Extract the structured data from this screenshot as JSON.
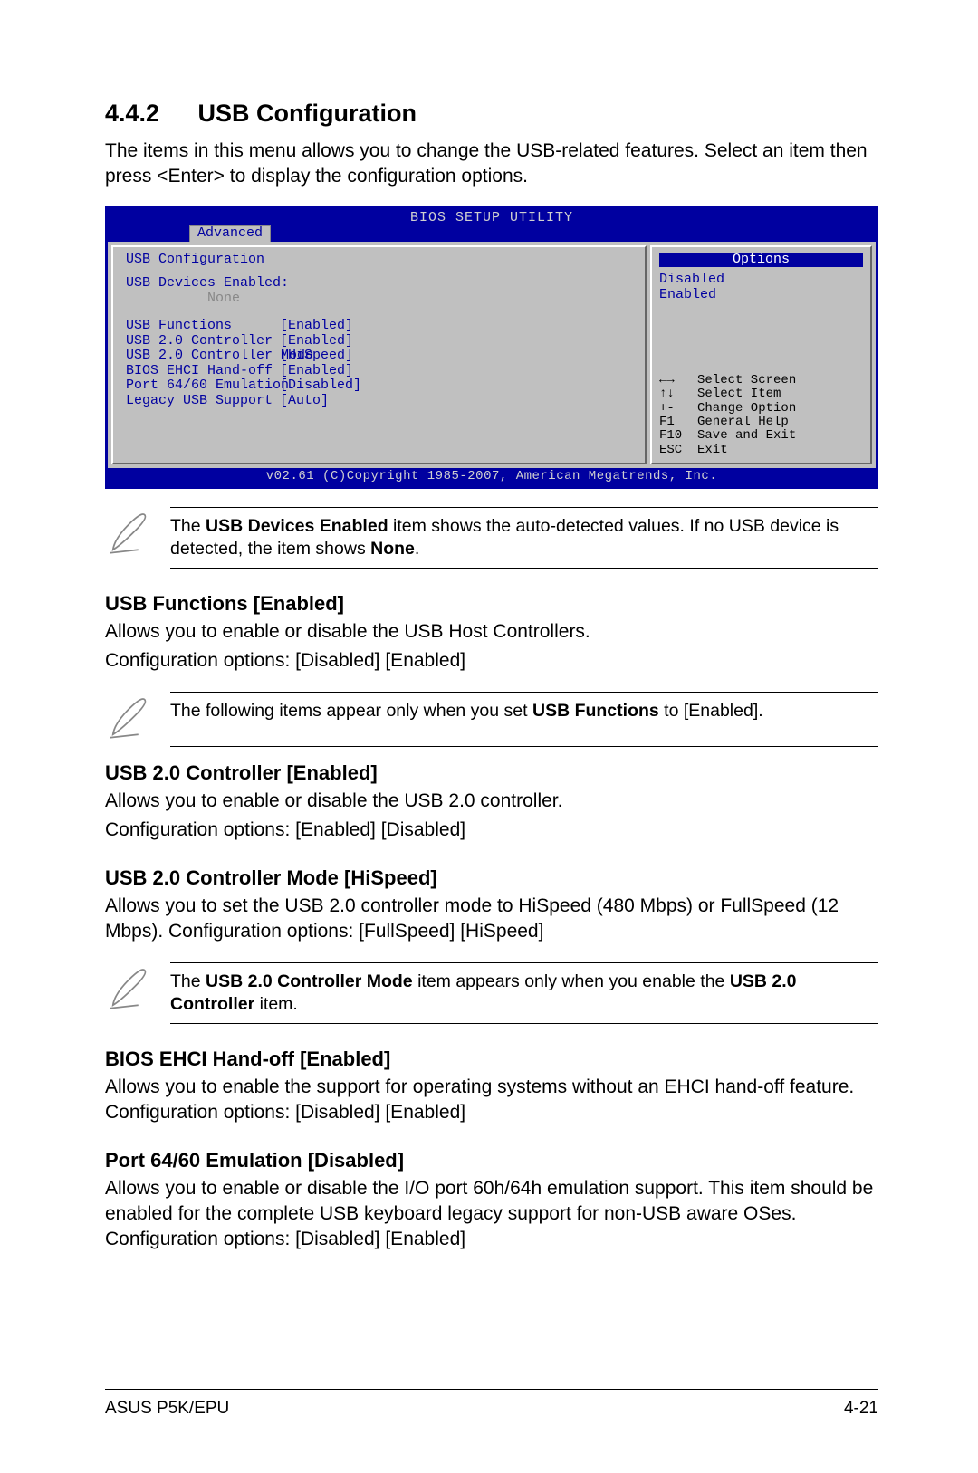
{
  "section": {
    "number": "4.4.2",
    "title": "USB Configuration"
  },
  "intro": "The items in this menu allows you to change the USB-related features. Select an item then press <Enter> to display the configuration options.",
  "bios": {
    "banner": "BIOS SETUP UTILITY",
    "tab": "Advanced",
    "menu_title": "USB Configuration",
    "devices_label": "USB Devices Enabled:",
    "devices_value": "None",
    "rows": [
      {
        "label": "USB Functions",
        "value": "[Enabled]"
      },
      {
        "label": "USB 2.0 Controller",
        "value": "[Enabled]"
      },
      {
        "label": "USB 2.0 Controller Mode",
        "value": "[HiSpeed]"
      },
      {
        "label": "BIOS EHCI Hand-off",
        "value": "[Enabled]"
      },
      {
        "label": "Port 64/60 Emulation",
        "value": "[Disabled]"
      },
      {
        "label": "Legacy USB Support",
        "value": "[Auto]"
      }
    ],
    "options_header": "Options",
    "options": [
      "Disabled",
      "Enabled"
    ],
    "help": [
      {
        "key": "←→",
        "text": "Select Screen"
      },
      {
        "key": "↑↓",
        "text": "Select Item"
      },
      {
        "key": "+-",
        "text": "Change Option"
      },
      {
        "key": "F1",
        "text": "General Help"
      },
      {
        "key": "F10",
        "text": "Save and Exit"
      },
      {
        "key": "ESC",
        "text": "Exit"
      }
    ],
    "copyright": "v02.61 (C)Copyright 1985-2007, American Megatrends, Inc."
  },
  "note1_a": "The ",
  "note1_b": "USB Devices Enabled",
  "note1_c": " item shows the auto-detected values. If no USB device is detected, the item shows ",
  "note1_d": "None",
  "note1_e": ".",
  "s1": {
    "h": "USB Functions [Enabled]",
    "p1": "Allows you to enable or disable the USB Host Controllers.",
    "p2": "Configuration options: [Disabled] [Enabled]"
  },
  "note2_a": "The following items appear only when you set ",
  "note2_b": "USB Functions",
  "note2_c": " to [Enabled].",
  "s2": {
    "h": "USB 2.0 Controller [Enabled]",
    "p1": "Allows you to enable or disable the USB 2.0 controller.",
    "p2": "Configuration options: [Enabled] [Disabled]"
  },
  "s3": {
    "h": "USB 2.0 Controller Mode [HiSpeed]",
    "p": "Allows you to set the USB 2.0 controller mode to HiSpeed (480 Mbps) or FullSpeed (12 Mbps). Configuration options: [FullSpeed] [HiSpeed]"
  },
  "note3_a": "The ",
  "note3_b": "USB 2.0 Controller Mode",
  "note3_c": " item appears only when you enable the ",
  "note3_d": "USB 2.0 Controller",
  "note3_e": " item.",
  "s4": {
    "h": "BIOS EHCI Hand-off [Enabled]",
    "p": "Allows you to enable the support for operating systems without an EHCI hand-off feature. Configuration options: [Disabled] [Enabled]"
  },
  "s5": {
    "h": "Port 64/60 Emulation [Disabled]",
    "p": "Allows you to enable or disable the I/O port 60h/64h emulation support. This item should be enabled for the complete USB keyboard legacy support for non-USB aware OSes. Configuration options: [Disabled] [Enabled]"
  },
  "footer": {
    "left": "ASUS P5K/EPU",
    "right": "4-21"
  }
}
